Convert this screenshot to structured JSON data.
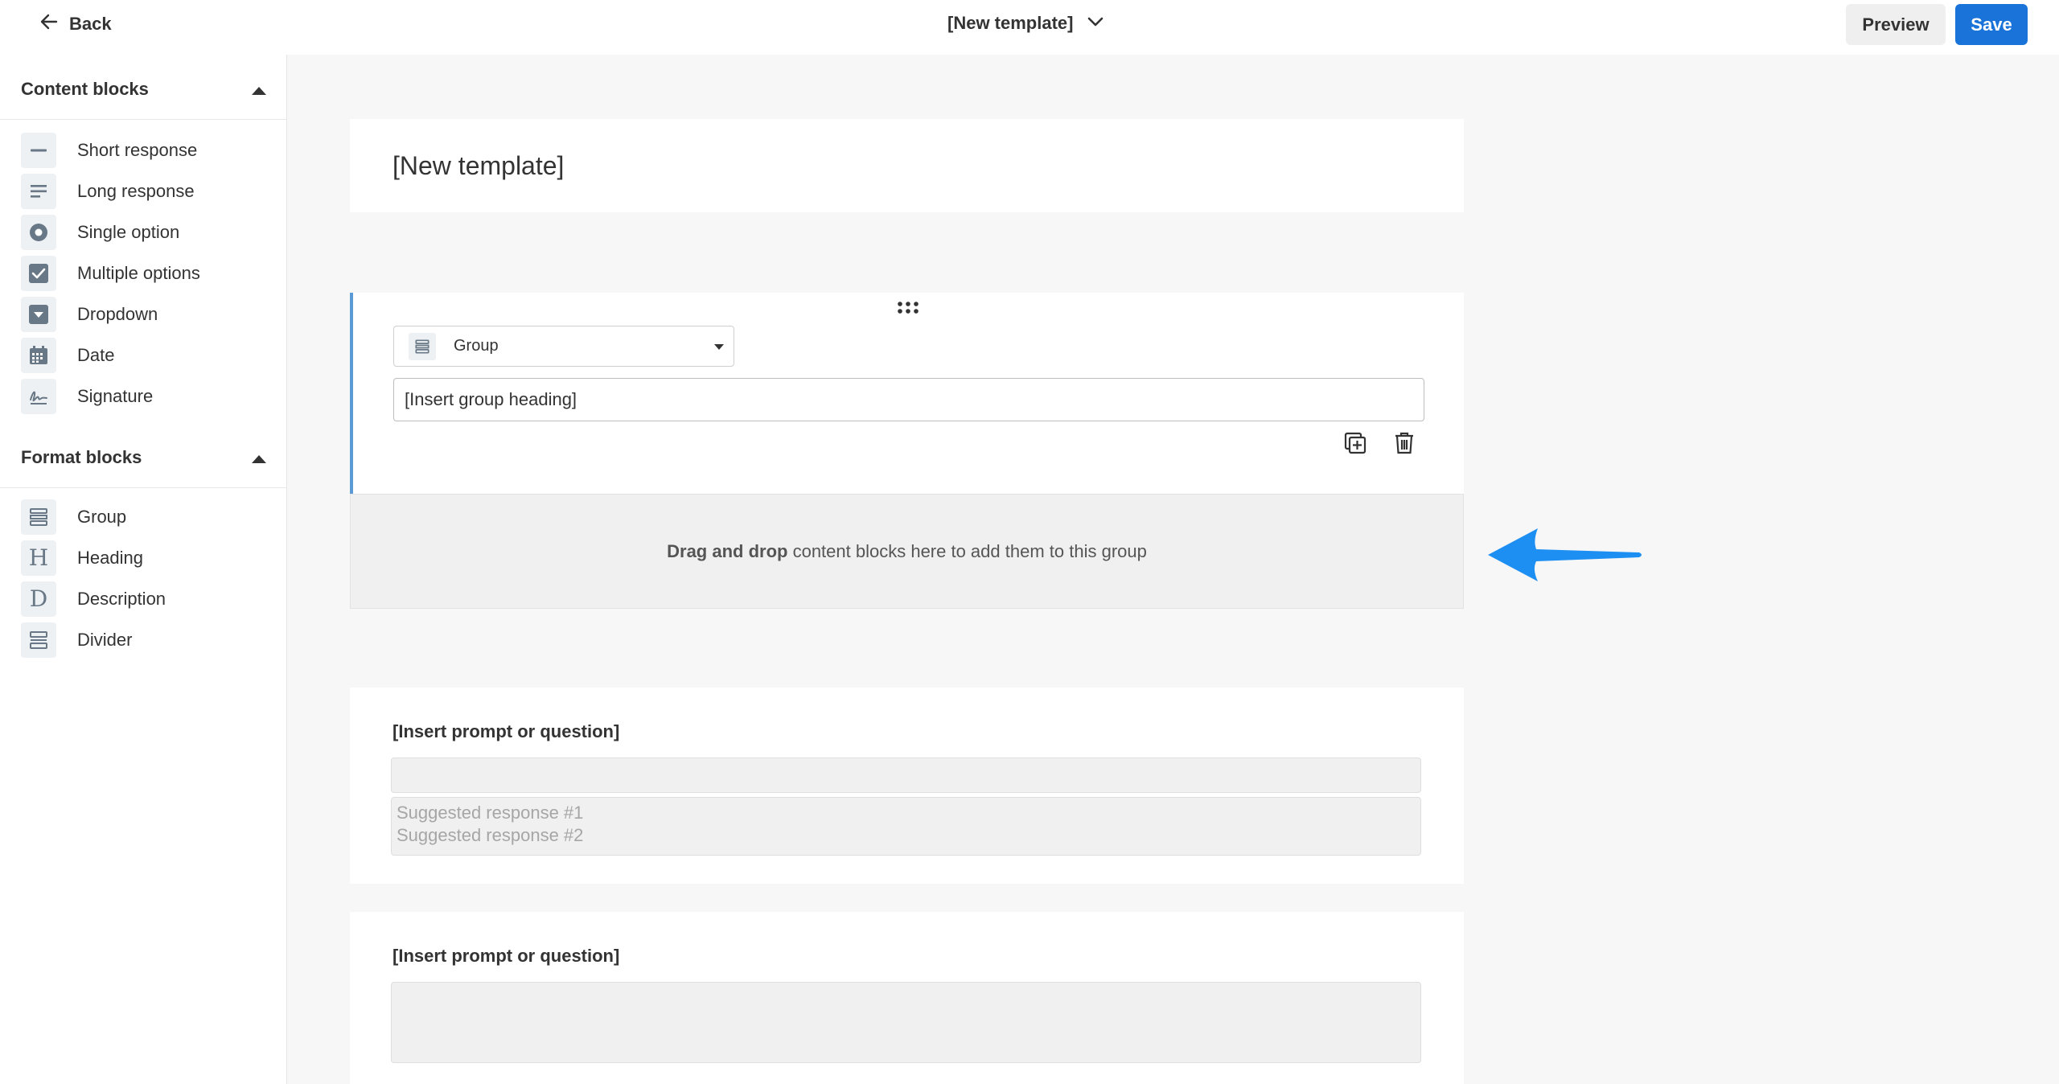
{
  "header": {
    "back_label": "Back",
    "template_name": "[New template]",
    "preview_label": "Preview",
    "save_label": "Save"
  },
  "sidebar": {
    "content_blocks": {
      "title": "Content blocks",
      "items": [
        {
          "label": "Short response",
          "icon": "short-response-icon"
        },
        {
          "label": "Long response",
          "icon": "long-response-icon"
        },
        {
          "label": "Single option",
          "icon": "radio-icon"
        },
        {
          "label": "Multiple options",
          "icon": "checkbox-icon"
        },
        {
          "label": "Dropdown",
          "icon": "dropdown-icon"
        },
        {
          "label": "Date",
          "icon": "calendar-icon"
        },
        {
          "label": "Signature",
          "icon": "signature-icon"
        }
      ]
    },
    "format_blocks": {
      "title": "Format blocks",
      "items": [
        {
          "label": "Group",
          "icon": "group-icon"
        },
        {
          "label": "Heading",
          "icon": "heading-icon"
        },
        {
          "label": "Description",
          "icon": "description-icon"
        },
        {
          "label": "Divider",
          "icon": "divider-icon"
        }
      ]
    }
  },
  "canvas": {
    "template_title": "[New template]",
    "group_block": {
      "type_label": "Group",
      "heading_value": "[Insert group heading]",
      "dropzone_bold": "Drag and drop",
      "dropzone_rest": " content blocks here to add them to this group"
    },
    "question_1": {
      "prompt": "[Insert prompt or question]",
      "suggestion_1": "Suggested response #1",
      "suggestion_2": "Suggested response #2"
    },
    "question_2": {
      "prompt": "[Insert prompt or question]"
    }
  },
  "colors": {
    "accent": "#1a73d9",
    "group_border": "#5b9bd5",
    "annotation_arrow": "#1e8ff2"
  }
}
